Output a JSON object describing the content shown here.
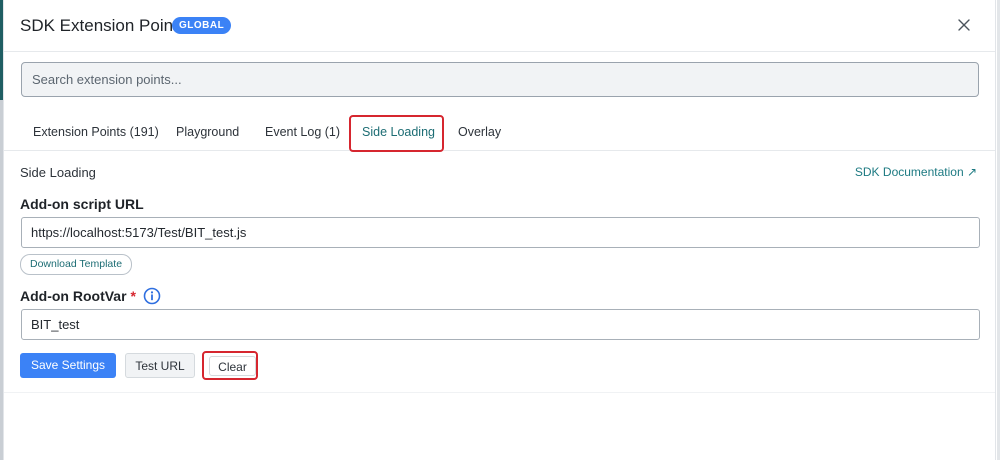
{
  "header": {
    "title": "SDK Extension Points",
    "badge": "GLOBAL",
    "close_icon": "close-icon"
  },
  "search": {
    "placeholder": "Search extension points...",
    "value": ""
  },
  "tabs": [
    {
      "label": "Extension Points (191)",
      "active": false
    },
    {
      "label": "Playground",
      "active": false
    },
    {
      "label": "Event Log (1)",
      "active": false
    },
    {
      "label": "Side Loading",
      "active": true
    },
    {
      "label": "Overlay",
      "active": false
    }
  ],
  "side_loading": {
    "section_title": "Side Loading",
    "doc_link": "SDK Documentation ↗",
    "script_url": {
      "label": "Add-on script URL",
      "value": "https://localhost:5173/Test/BIT_test.js"
    },
    "download_template": "Download Template",
    "root_var": {
      "label": "Add-on RootVar",
      "required_marker": "*",
      "value": "BIT_test",
      "info_icon": "info-circle-icon"
    }
  },
  "actions": {
    "save_label": "Save Settings",
    "test_label": "Test URL",
    "clear_label": "Clear"
  },
  "colors": {
    "accent": "#3b82f6",
    "link": "#1d7a82",
    "highlight": "#d6262f"
  }
}
